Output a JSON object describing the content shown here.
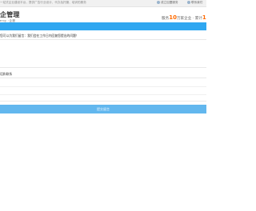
{
  "topbar": {
    "notice": "一站式企业建设平台，提供广告行业设计、代办及托管、培训的服务",
    "right_link_1": "成立加盟服务",
    "right_link_2": "联系我们"
  },
  "header": {
    "logo_main": "企管理",
    "logo_sub": "eng ·企服",
    "stats_prefix": "服务",
    "stats_num_1": "10",
    "stats_mid": "万家企业 · 累计",
    "stats_num_2": "1"
  },
  "form": {
    "question_1": "您可以为我们留言：我们会在工作日内回复您提出的问题！",
    "question_2": "话和联系",
    "submit_label": "提交留言"
  },
  "colors": {
    "nav": "#2fa7f1",
    "submit": "#62b7ee",
    "accent_number": "#ff6a00"
  }
}
